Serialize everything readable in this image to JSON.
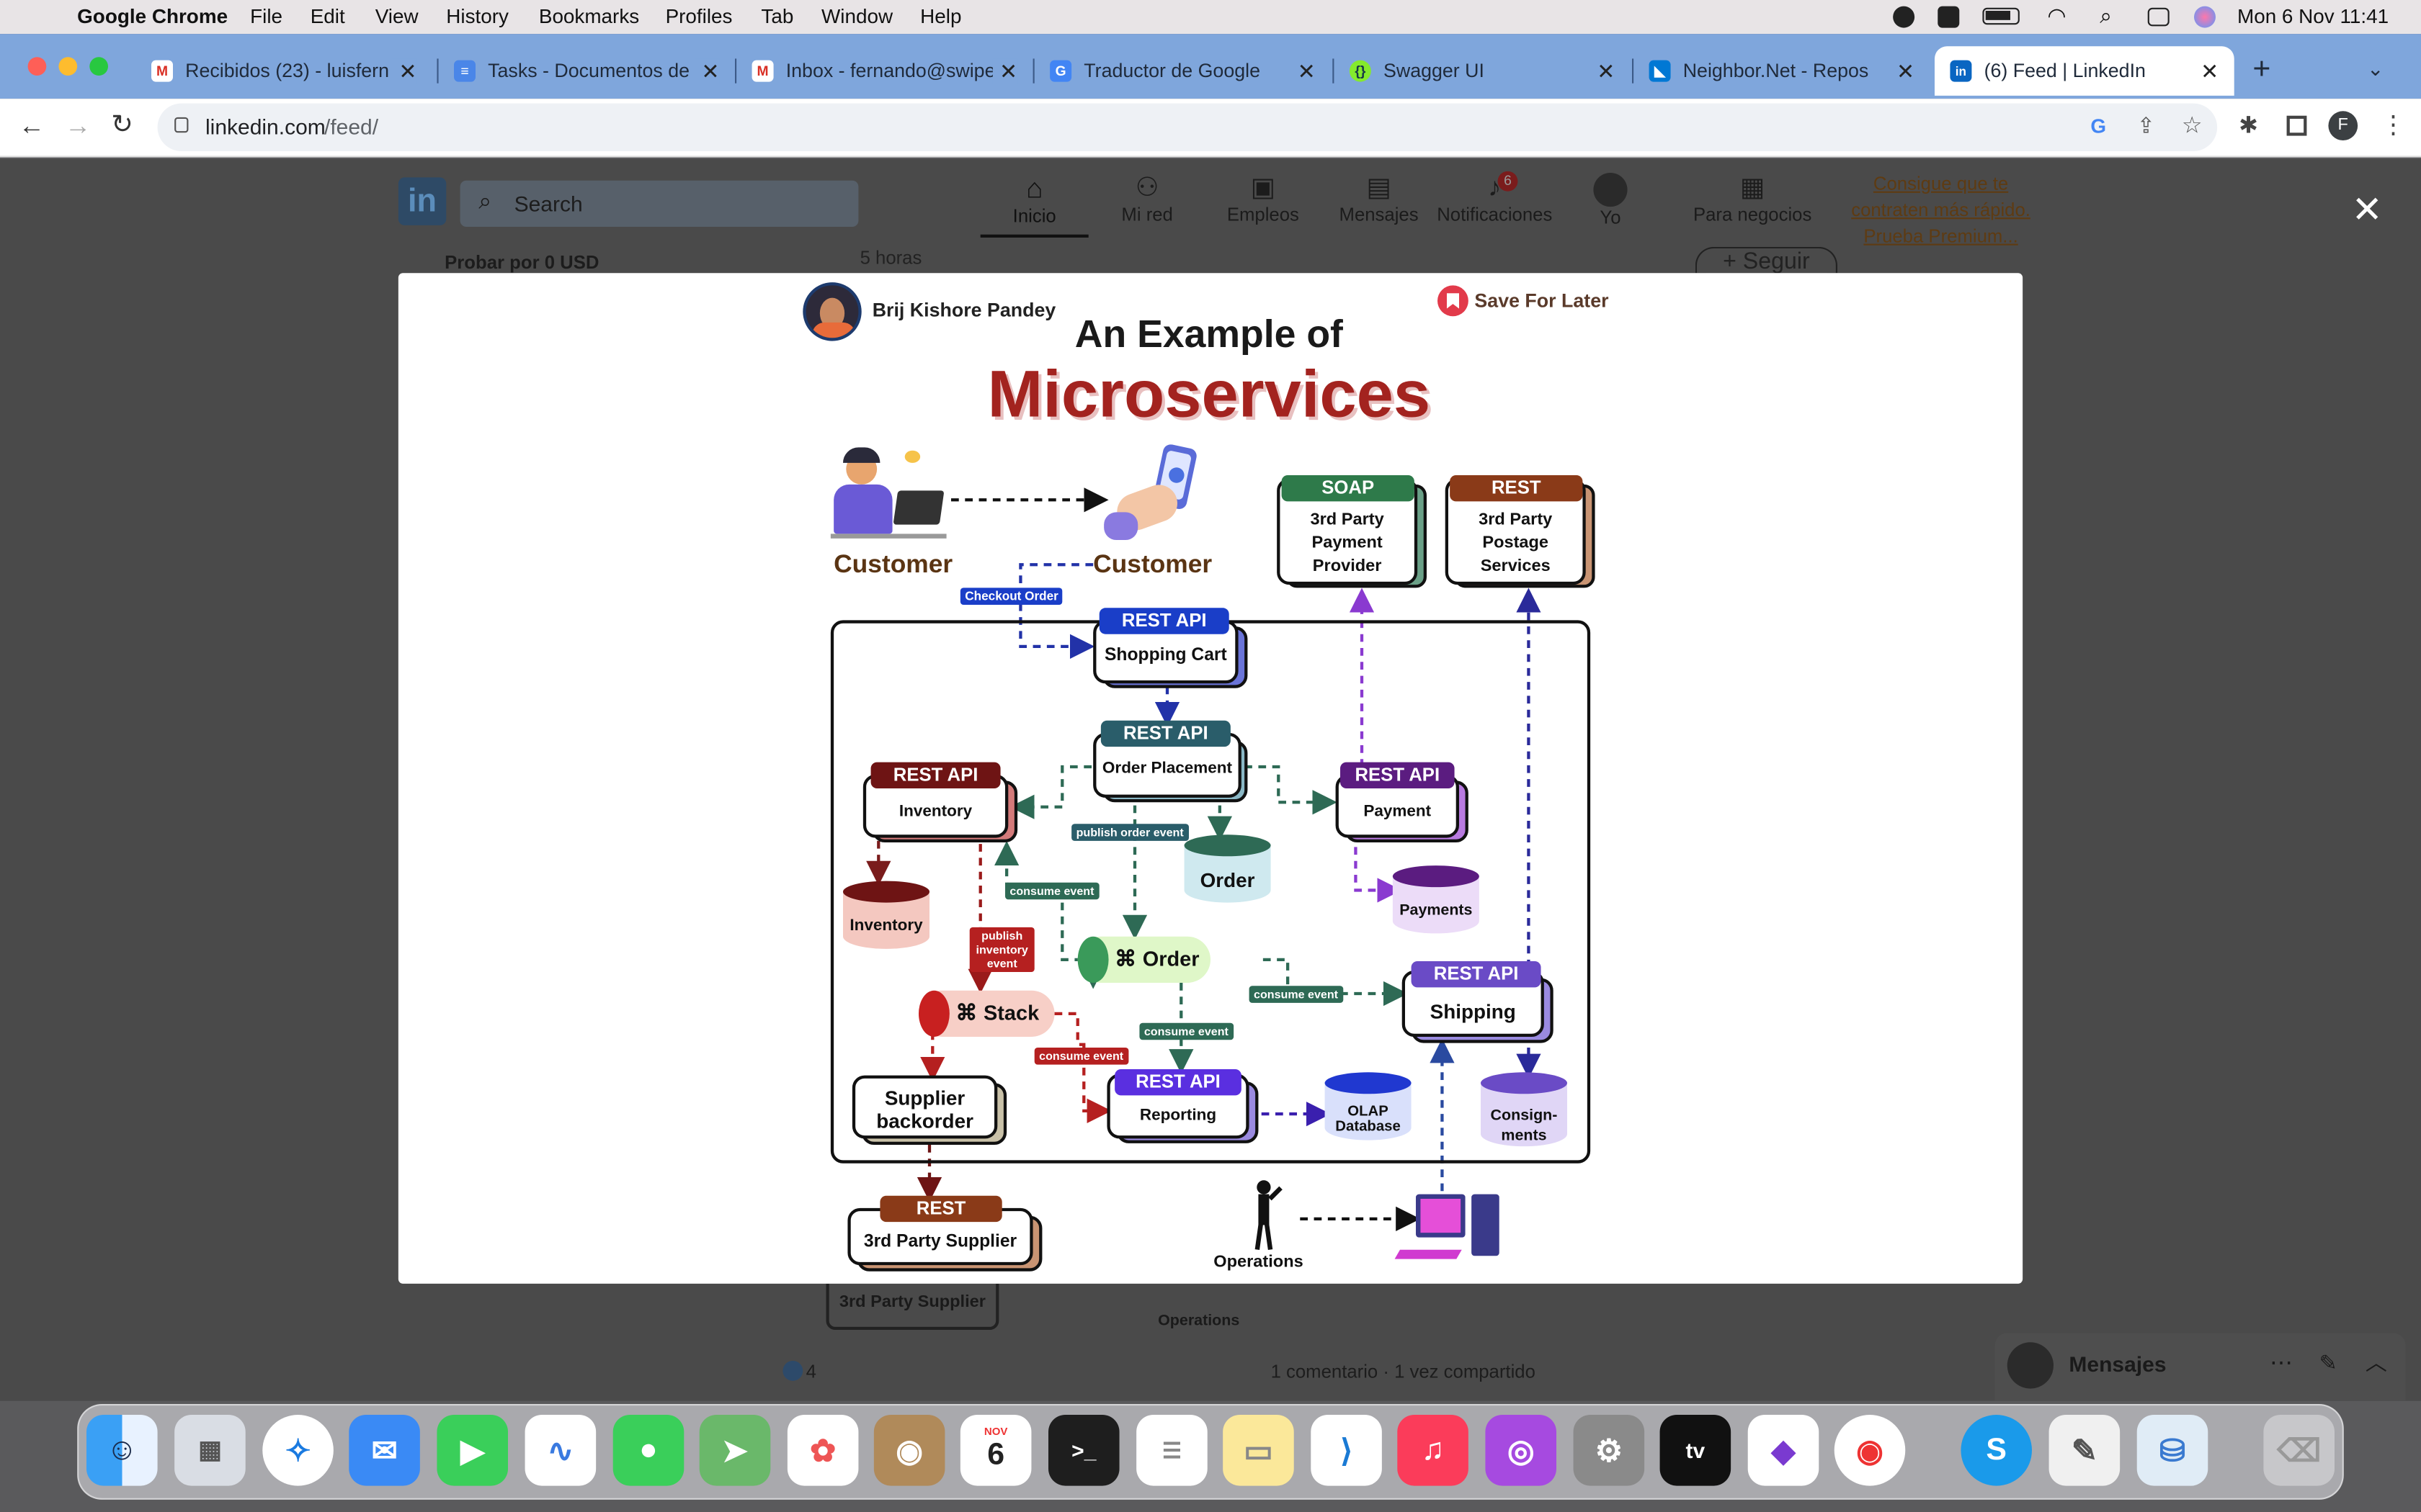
{
  "menubar": {
    "items": [
      "Google Chrome",
      "File",
      "Edit",
      "View",
      "History",
      "Bookmarks",
      "Profiles",
      "Tab",
      "Window",
      "Help"
    ],
    "datetime": "Mon 6 Nov  11:41"
  },
  "browser": {
    "tabs": [
      {
        "label": "Recibidos (23) - luisfern",
        "favicon": "gmail-icon"
      },
      {
        "label": "Tasks - Documentos de G",
        "favicon": "docs-icon"
      },
      {
        "label": "Inbox - fernando@swipe",
        "favicon": "gmail-icon"
      },
      {
        "label": "Traductor de Google",
        "favicon": "translate-icon"
      },
      {
        "label": "Swagger UI",
        "favicon": "swagger-icon"
      },
      {
        "label": "Neighbor.Net - Repos",
        "favicon": "azure-devops-icon"
      },
      {
        "label": "(6) Feed | LinkedIn",
        "favicon": "linkedin-icon"
      }
    ],
    "url_host": "linkedin.com",
    "url_path": "/feed/",
    "profile_initial": "F"
  },
  "linkedin": {
    "search_placeholder": "Search",
    "nav": [
      {
        "label": "Inicio"
      },
      {
        "label": "Mi red"
      },
      {
        "label": "Empleos"
      },
      {
        "label": "Mensajes"
      },
      {
        "label": "Notificaciones",
        "badge": "6"
      },
      {
        "label": "Yo"
      },
      {
        "label": "Para negocios"
      }
    ],
    "premium_promo": "Consigue que te contraten más rápido. Prueba Premium...",
    "left_promo": "Probar por 0 USD",
    "post_time": "5 horas",
    "follow_label": "+ Seguir",
    "post_bottom_left": "3rd Party Supplier",
    "post_bottom_mid": "Operations",
    "reactions": "4",
    "stats": "1 comentario · 1 vez compartido",
    "messages_label": "Mensajes"
  },
  "modal": {
    "author": "Brij Kishore Pandey",
    "save_label": "Save For Later",
    "title_line1": "An Example of",
    "title_line2": "Microservices",
    "diagram": {
      "customer1": "Customer",
      "customer2": "Customer",
      "checkout": "Checkout Order",
      "soap_hdr": "SOAP",
      "soap_body": "3rd Party Payment Provider",
      "rest_post_hdr": "REST",
      "rest_post_body": "3rd Party Postage Services",
      "rest_api": "REST API",
      "cart": "Shopping Cart",
      "order_placement": "Order Placement",
      "inventory": "Inventory",
      "payment": "Payment",
      "publish_order": "publish order event",
      "order_db": "Order",
      "inventory_db": "Inventory",
      "payments_db": "Payments",
      "consume_event": "consume event",
      "publish_inv": "publish inventory event",
      "order_topic": "Order",
      "stack_topic": "Stack",
      "shipping": "Shipping",
      "reporting": "Reporting",
      "olap": "OLAP Database",
      "consign": "Consign- ments",
      "supplier_backorder": "Supplier backorder",
      "rest_hdr": "REST",
      "third_supplier": "3rd Party Supplier",
      "operations": "Operations"
    }
  },
  "colors": {
    "tabstrip": "#7fa6dc",
    "linkedin_blue": "#0a66c2",
    "title_red": "#a3231f",
    "cart_blue": "#1a3ec8",
    "order_teal": "#2a5d6a",
    "inventory_red": "#6e1414",
    "payment_purple": "#5b1c80",
    "shipping_purple": "#6a4bc6",
    "reporting_violet": "#5a2fe0"
  }
}
